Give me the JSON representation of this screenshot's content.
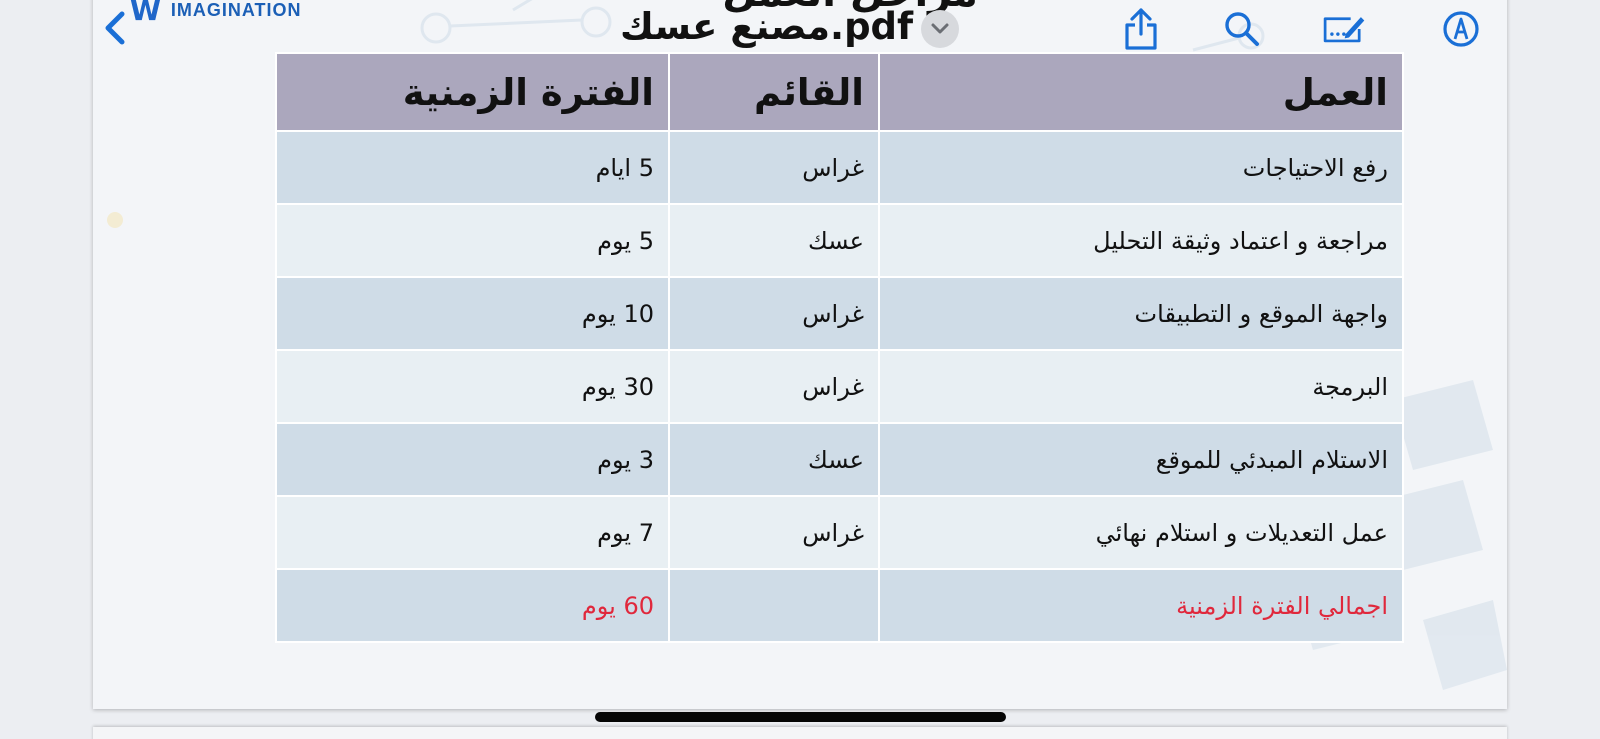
{
  "toolbar": {
    "document_title": "مصنع عسك.pdf",
    "back_icon": "chevron-left-icon",
    "title_menu_icon": "chevron-down-icon",
    "share_icon": "share-icon",
    "search_icon": "search-icon",
    "markup_icon": "markup-icon",
    "pencil_icon": "pencil-circle-icon",
    "accent_color": "#1a6fd6"
  },
  "slide": {
    "title": "مراحل العمل",
    "logo_text": "IMAGINATION"
  },
  "table": {
    "headers": [
      "العمل",
      "القائم",
      "الفترة الزمنية"
    ],
    "rows": [
      [
        "رفع الاحتياجات",
        "غراس",
        "5 ايام"
      ],
      [
        "مراجعة و اعتماد وثيقة التحليل",
        "عسك",
        "5 يوم"
      ],
      [
        "واجهة الموقع و التطبيقات",
        "غراس",
        "10 يوم"
      ],
      [
        "البرمجة",
        "غراس",
        "30 يوم"
      ],
      [
        "الاستلام المبدئي للموقع",
        "عسك",
        "3 يوم"
      ],
      [
        "عمل التعديلات و استلام نهائي",
        "غراس",
        "7 يوم"
      ]
    ],
    "total": {
      "label": "اجمالي الفترة الزمنية",
      "owner": "",
      "duration": "60 يوم"
    },
    "header_color": "#aba7bd",
    "total_text_color": "#e0283c"
  }
}
